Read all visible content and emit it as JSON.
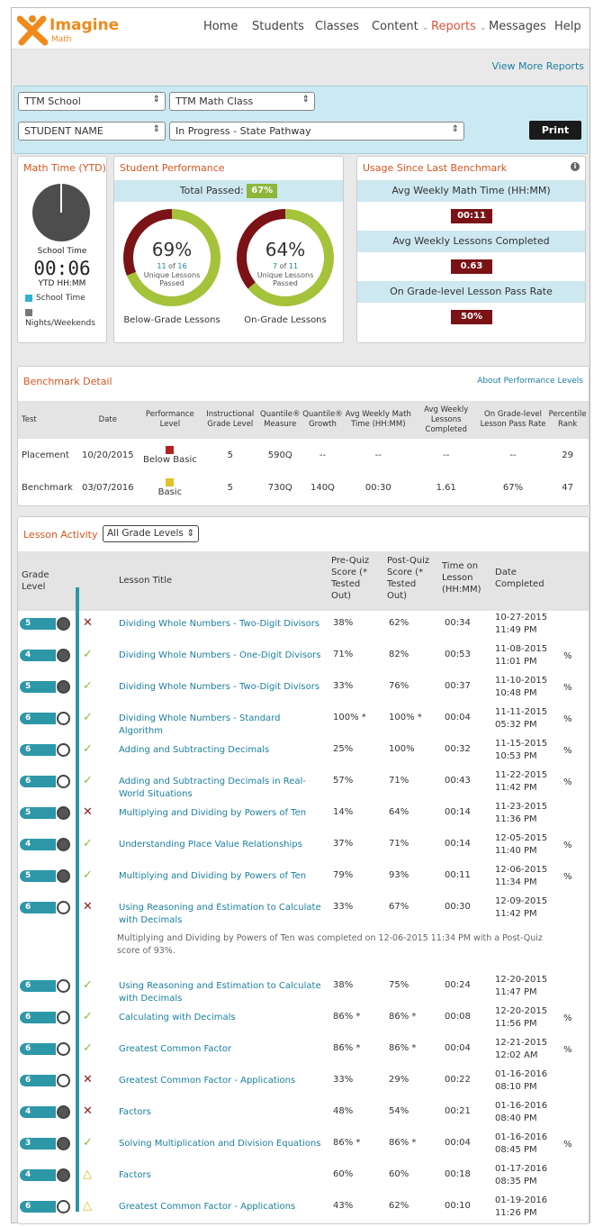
{
  "app": {
    "logo_text": "Imagine",
    "logo_sub": "Math",
    "brand_color": "#f08a1c",
    "accent": "#1a7fa0"
  },
  "nav": {
    "home": "Home",
    "students": "Students",
    "classes": "Classes",
    "content": "Content",
    "reports": "Reports",
    "messages": "Messages",
    "help": "Help"
  },
  "view_more": "View More Reports",
  "filters": {
    "school": "TTM School",
    "class": "TTM Math Class",
    "student": "STUDENT NAME",
    "pathway": "In Progress - State Pathway",
    "print": "Print"
  },
  "math_time": {
    "title": "Math Time (YTD)",
    "school_time_label": "School Time",
    "time": "00:06",
    "ytd_label": "YTD HH:MM",
    "legend_school": "School Time",
    "legend_nights": "Nights/Weekends"
  },
  "performance": {
    "title": "Student Performance",
    "total_passed_label": "Total Passed:",
    "total_passed": "67%",
    "below": {
      "pct": "69%",
      "passed": "11",
      "of": "of",
      "total": "16",
      "line1": "Unique Lessons",
      "line2": "Passed",
      "caption": "Below-Grade Lessons",
      "fraction": 0.69
    },
    "on": {
      "pct": "64%",
      "passed": "7",
      "of": "of",
      "total": "11",
      "line1": "Unique Lessons",
      "line2": "Passed",
      "caption": "On-Grade Lessons",
      "fraction": 0.64
    }
  },
  "usage": {
    "title": "Usage Since Last Benchmark",
    "info_icon": "i",
    "weekly_time_label": "Avg Weekly Math Time (HH:MM)",
    "weekly_time": "00:11",
    "weekly_lessons_label": "Avg Weekly Lessons Completed",
    "weekly_lessons": "0.63",
    "pass_rate_label": "On Grade-level Lesson Pass Rate",
    "pass_rate": "50%"
  },
  "benchmark": {
    "title": "Benchmark Detail",
    "link": "About Performance Levels",
    "headers": [
      "Test",
      "Date",
      "Performance Level",
      "Instructional Grade Level",
      "Quantile® Measure",
      "Quantile® Growth",
      "Avg Weekly Math Time (HH:MM)",
      "Avg Weekly Lessons Completed",
      "On Grade-level Lesson Pass Rate",
      "Percentile Rank"
    ],
    "rows": [
      {
        "test": "Placement",
        "date": "10/20/2015",
        "level": "Below Basic",
        "level_color": "#b22222",
        "grade": "5",
        "measure": "590Q",
        "growth": "--",
        "time": "--",
        "lessons": "--",
        "rate": "--",
        "rank": "29"
      },
      {
        "test": "Benchmark",
        "date": "03/07/2016",
        "level": "Basic",
        "level_color": "#e0c22a",
        "grade": "5",
        "measure": "730Q",
        "growth": "140Q",
        "time": "00:30",
        "lessons": "1.61",
        "rate": "67%",
        "rank": "47"
      }
    ]
  },
  "lessons": {
    "title": "Lesson Activity",
    "filter": "All Grade Levels",
    "headers": {
      "grade": "Grade Level",
      "title": "Lesson Title",
      "pre": "Pre-Quiz Score (* Tested Out)",
      "post": "Post-Quiz Score (* Tested Out)",
      "time": "Time on Lesson (HH:MM)",
      "date": "Date Completed"
    },
    "rows": [
      {
        "grade": "5",
        "mark": "x",
        "title": "Dividing Whole Numbers - Two-Digit Divisors",
        "pre": "38%",
        "post": "62%",
        "time": "00:34",
        "date": "10-27-2015",
        "clock": "11:49 PM",
        "pct": ""
      },
      {
        "grade": "4",
        "mark": "c",
        "title": "Dividing Whole Numbers - One-Digit Divisors",
        "pre": "71%",
        "post": "82%",
        "time": "00:53",
        "date": "11-08-2015",
        "clock": "11:01 PM",
        "pct": "%"
      },
      {
        "grade": "5",
        "mark": "c",
        "title": "Dividing Whole Numbers - Two-Digit Divisors",
        "pre": "33%",
        "post": "76%",
        "time": "00:37",
        "date": "11-10-2015",
        "clock": "10:48 PM",
        "pct": "%"
      },
      {
        "grade": "6",
        "mark": "c",
        "title": "Dividing Whole Numbers - Standard Algorithm",
        "pre": "100% *",
        "post": "100% *",
        "time": "00:04",
        "date": "11-11-2015",
        "clock": "05:32 PM",
        "pct": "%"
      },
      {
        "grade": "6",
        "mark": "c",
        "title": "Adding and Subtracting Decimals",
        "pre": "25%",
        "post": "100%",
        "time": "00:32",
        "date": "11-15-2015",
        "clock": "10:53 PM",
        "pct": "%"
      },
      {
        "grade": "6",
        "mark": "c",
        "title": "Adding and Subtracting Decimals in Real-World Situations",
        "pre": "57%",
        "post": "71%",
        "time": "00:43",
        "date": "11-22-2015",
        "clock": "11:42 PM",
        "pct": "%"
      },
      {
        "grade": "5",
        "mark": "x",
        "title": "Multiplying and Dividing by Powers of Ten",
        "pre": "14%",
        "post": "64%",
        "time": "00:14",
        "date": "11-23-2015",
        "clock": "11:36 PM",
        "pct": ""
      },
      {
        "grade": "4",
        "mark": "c",
        "title": "Understanding Place Value Relationships",
        "pre": "37%",
        "post": "71%",
        "time": "00:14",
        "date": "12-05-2015",
        "clock": "11:40 PM",
        "pct": "%"
      },
      {
        "grade": "5",
        "mark": "c",
        "title": "Multiplying and Dividing by Powers of Ten",
        "pre": "79%",
        "post": "93%",
        "time": "00:11",
        "date": "12-06-2015",
        "clock": "11:34 PM",
        "pct": "%"
      },
      {
        "grade": "6",
        "mark": "x",
        "title": "Using Reasoning and Estimation to Calculate with Decimals",
        "pre": "33%",
        "post": "67%",
        "time": "00:30",
        "date": "12-09-2015",
        "clock": "11:42 PM",
        "pct": ""
      },
      {
        "grade": "6",
        "mark": "c",
        "title": "Using Reasoning and Estimation to Calculate with Decimals",
        "pre": "38%",
        "post": "75%",
        "time": "00:24",
        "date": "12-20-2015",
        "clock": "11:47 PM",
        "pct": ""
      },
      {
        "grade": "6",
        "mark": "c",
        "title": "Calculating with Decimals",
        "pre": "86% *",
        "post": "86% *",
        "time": "00:08",
        "date": "12-20-2015",
        "clock": "11:56 PM",
        "pct": "%"
      },
      {
        "grade": "6",
        "mark": "c",
        "title": "Greatest Common Factor",
        "pre": "86% *",
        "post": "86% *",
        "time": "00:04",
        "date": "12-21-2015",
        "clock": "12:02 AM",
        "pct": "%"
      },
      {
        "grade": "6",
        "mark": "x",
        "title": "Greatest Common Factor - Applications",
        "pre": "33%",
        "post": "29%",
        "time": "00:22",
        "date": "01-16-2016",
        "clock": "08:10 PM",
        "pct": ""
      },
      {
        "grade": "4",
        "mark": "x",
        "title": "Factors",
        "pre": "48%",
        "post": "54%",
        "time": "00:21",
        "date": "01-16-2016",
        "clock": "08:40 PM",
        "pct": ""
      },
      {
        "grade": "3",
        "mark": "c",
        "title": "Solving Multiplication and Division Equations",
        "pre": "86% *",
        "post": "86% *",
        "time": "00:04",
        "date": "01-16-2016",
        "clock": "08:45 PM",
        "pct": "%"
      },
      {
        "grade": "4",
        "mark": "w",
        "title": "Factors",
        "pre": "60%",
        "post": "60%",
        "time": "00:18",
        "date": "01-17-2016",
        "clock": "08:35 PM",
        "pct": ""
      },
      {
        "grade": "6",
        "mark": "w",
        "title": "Greatest Common Factor - Applications",
        "pre": "43%",
        "post": "62%",
        "time": "00:10",
        "date": "01-19-2016",
        "clock": "11:26 PM",
        "pct": ""
      }
    ],
    "note": "Multiplying and Dividing by Powers of Ten was completed on 12-06-2015 11:34 PM with a Post-Quiz score of 93%."
  }
}
